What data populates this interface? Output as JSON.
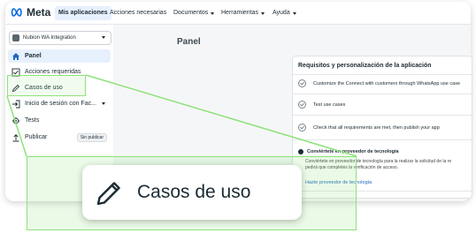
{
  "topbar": {
    "brand": "Meta",
    "nav": [
      {
        "label": "Mis aplicaciones",
        "active": true,
        "dropdown": false
      },
      {
        "label": "Acciones necesarias",
        "active": false,
        "dropdown": false
      },
      {
        "label": "Documentos",
        "active": false,
        "dropdown": true
      },
      {
        "label": "Herramientas",
        "active": false,
        "dropdown": true
      },
      {
        "label": "Ayuda",
        "active": false,
        "dropdown": true
      }
    ]
  },
  "sidebar": {
    "app_selector": "Nubion WA Integration",
    "items": [
      {
        "label": "Panel",
        "icon": "home-icon",
        "active": true
      },
      {
        "label": "Acciones requeridas",
        "icon": "checklist-icon",
        "active": false
      },
      {
        "label": "Casos de uso",
        "icon": "pencil-icon",
        "active": false
      },
      {
        "label": "Inicio de sesión con Fac...",
        "icon": "login-icon",
        "active": false
      },
      {
        "label": "Tests",
        "icon": "gear-icon",
        "active": false
      },
      {
        "label": "Publicar",
        "icon": "upload-icon",
        "active": false,
        "badge": "Sin publicar"
      }
    ]
  },
  "main": {
    "title": "Panel",
    "card": {
      "title": "Requisitos y personalización de la aplicación",
      "requirements": [
        "Customize the Connect with customers through WhatsApp use case",
        "Test use cases",
        "Check that all requirements are met, then publish your app"
      ],
      "notice": {
        "title": "Conviértete en proveedor de tecnología",
        "body_line1": "Conviértete en proveedor de tecnología para la realizar la solicitud de la re",
        "body_line2": "pedirá que completes la verificación de acceso.",
        "link": "Hazte proveedor de tecnología"
      }
    }
  },
  "callout": {
    "label": "Casos de uso",
    "icon": "pencil-icon"
  },
  "colors": {
    "highlight": "#8de27a",
    "accent": "#1d65c1",
    "active_bg": "#e7f0fd"
  }
}
